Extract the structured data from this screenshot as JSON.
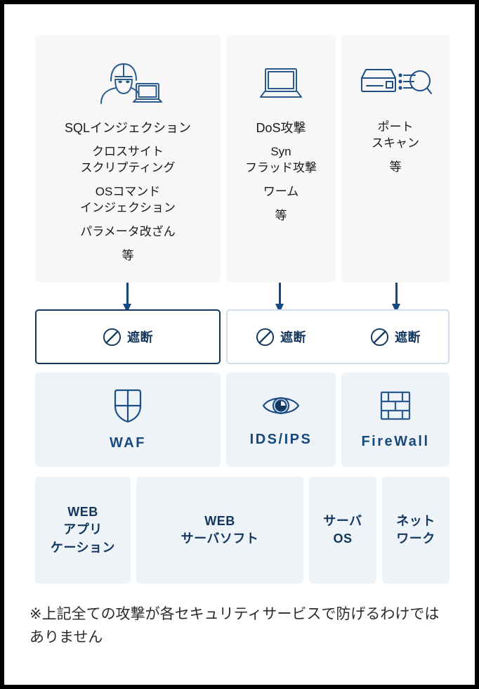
{
  "diagram": {
    "colors": {
      "panel_bg": "#f7f7f7",
      "card_bg": "#eef3f8",
      "navy": "#13365e",
      "accent": "#16497c",
      "arrow": "#144a80",
      "border_light": "#cfdce8"
    },
    "attack_panels": [
      {
        "icon": "hacker-laptop-icon",
        "items": [
          "SQLインジェクション",
          "クロスサイト\nスクリプティング",
          "OSコマンド\nインジェクション",
          "パラメータ改ざん",
          "等"
        ]
      },
      {
        "icon": "laptop-icon",
        "items": [
          "DoS攻撃",
          "Syn\nフラッド攻撃",
          "ワーム",
          "等"
        ]
      },
      {
        "icon": "server-scan-icon",
        "items": [
          "ポート\nスキャン",
          "等"
        ]
      }
    ],
    "block_row": {
      "label": "遮断",
      "icon": "ban-icon",
      "boxes": [
        {
          "label": "遮断"
        },
        {
          "label": "遮断"
        },
        {
          "label": "遮断"
        }
      ]
    },
    "services": [
      {
        "icon": "shield-icon",
        "label": "WAF"
      },
      {
        "icon": "eye-icon",
        "label": "IDS/IPS"
      },
      {
        "icon": "brickwall-icon",
        "label": "FireWall"
      }
    ],
    "assets": [
      {
        "label": "WEB\nアプリ\nケーション"
      },
      {
        "label": "WEB\nサーバソフト"
      },
      {
        "label": "サーバ\nOS"
      },
      {
        "label": "ネット\nワーク"
      }
    ],
    "footnote": "※上記全ての攻撃が各セキュリティサービスで防げるわけではありません"
  }
}
